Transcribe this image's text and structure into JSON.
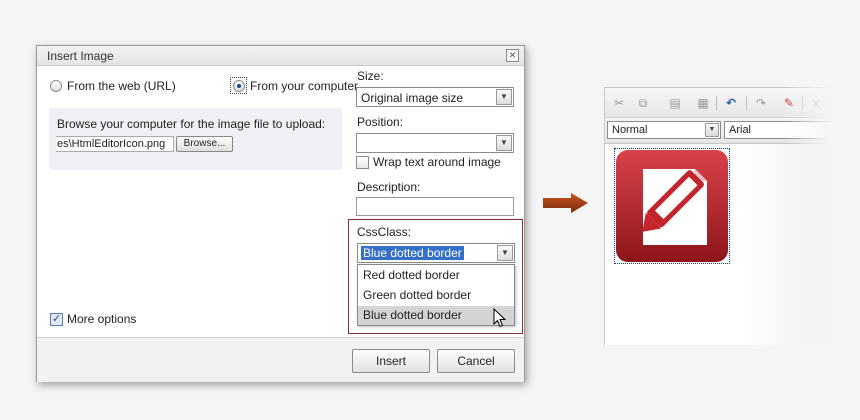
{
  "dialog": {
    "title": "Insert Image",
    "close_glyph": "✕",
    "source": {
      "web_label": "From the web (URL)",
      "computer_label": "From your computer",
      "selected": "computer"
    },
    "browse": {
      "prompt": "Browse your computer for the image file to upload:",
      "file_value": "es\\HtmlEditorIcon.png",
      "button_label": "Browse..."
    },
    "size": {
      "label": "Size:",
      "value": "Original image size"
    },
    "position": {
      "label": "Position:",
      "value": ""
    },
    "wrap": {
      "label": "Wrap text around image",
      "checked": false
    },
    "description": {
      "label": "Description:",
      "value": ""
    },
    "cssclass": {
      "label": "CssClass:",
      "value": "Blue dotted border",
      "options": [
        "Red dotted border",
        "Green dotted border",
        "Blue dotted border"
      ],
      "hovered_index": 2
    },
    "more_options": {
      "label": "More options",
      "checked": true
    },
    "insert_label": "Insert",
    "cancel_label": "Cancel"
  },
  "editor": {
    "toolbar_icons": [
      "cut-icon",
      "copy-icon",
      "paste-icon",
      "paste-from-word-icon",
      "undo-icon",
      "redo-icon",
      "spellcheck-icon",
      "more-icon"
    ],
    "format_value": "Normal",
    "font_value": "Arial",
    "image_name": "html-editor-icon",
    "image_border_color": "#1a2fb0"
  },
  "colors": {
    "accent_red": "#c2262c",
    "arrow_brown": "#9b3512",
    "selection_blue": "#3470c9"
  }
}
